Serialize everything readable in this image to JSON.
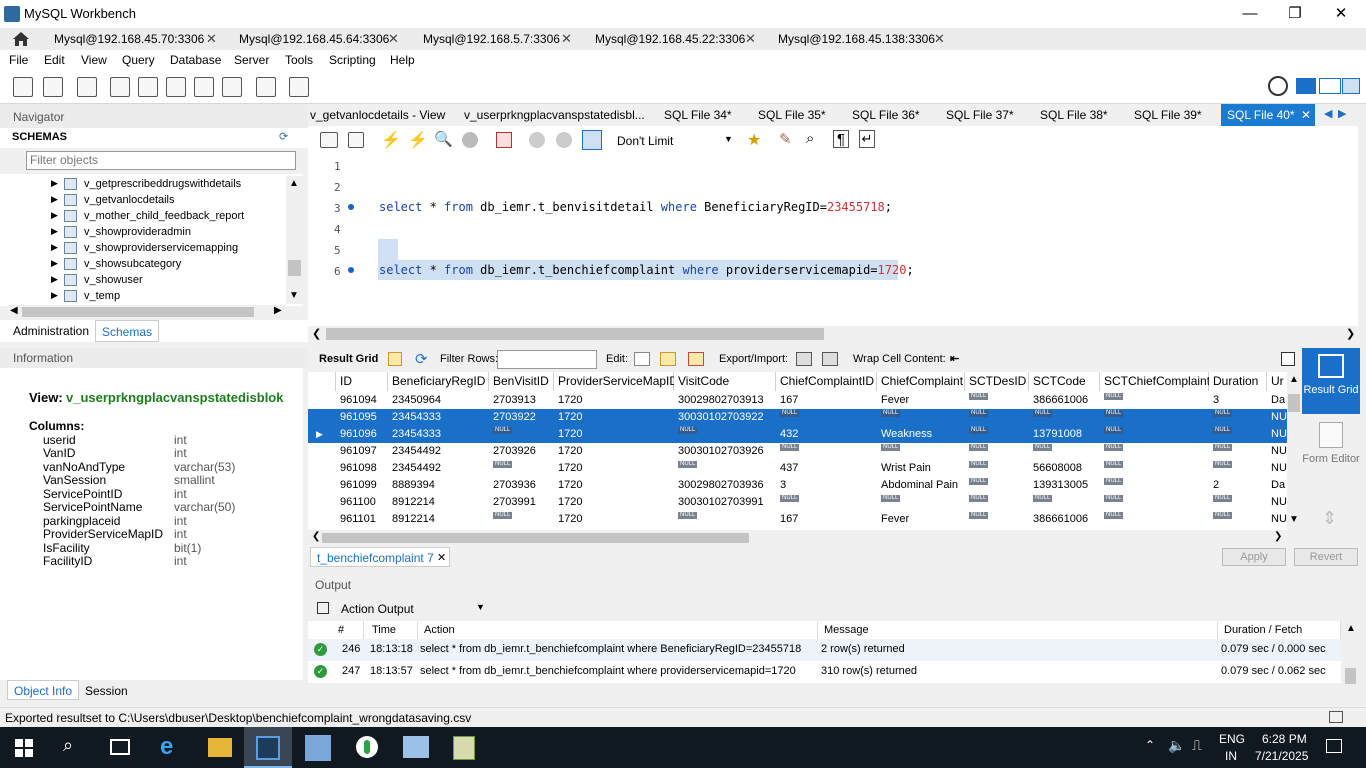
{
  "window": {
    "title": "MySQL Workbench",
    "minimize": "—",
    "maximize": "❐",
    "close": "✕"
  },
  "connection_tabs": [
    {
      "label": "Mysql@192.168.45.70:3306"
    },
    {
      "label": "Mysql@192.168.45.64:3306"
    },
    {
      "label": "Mysql@192.168.5.7:3306"
    },
    {
      "label": "Mysql@192.168.45.22:3306"
    },
    {
      "label": "Mysql@192.168.45.138:3306"
    }
  ],
  "menu": [
    "File",
    "Edit",
    "View",
    "Query",
    "Database",
    "Server",
    "Tools",
    "Scripting",
    "Help"
  ],
  "navigator": {
    "title": "Navigator",
    "schemas_label": "SCHEMAS",
    "filter_placeholder": "Filter objects",
    "tree": [
      "v_getprescribeddrugswithdetails",
      "v_getvanlocdetails",
      "v_mother_child_feedback_report",
      "v_showprovideradmin",
      "v_showproviderservicemapping",
      "v_showsubcategory",
      "v_showuser",
      "v_temp"
    ],
    "tabs": [
      "Administration",
      "Schemas"
    ]
  },
  "information": {
    "title": "Information",
    "view_label": "View:",
    "view_name": "v_userprkngplacvanspstatedisblok",
    "columns_label": "Columns:",
    "columns": [
      {
        "name": "userid",
        "type": "int"
      },
      {
        "name": "VanID",
        "type": "int"
      },
      {
        "name": "vanNoAndType",
        "type": "varchar(53)"
      },
      {
        "name": "VanSession",
        "type": "smallint"
      },
      {
        "name": "ServicePointID",
        "type": "int"
      },
      {
        "name": "ServicePointName",
        "type": "varchar(50)"
      },
      {
        "name": "parkingplaceid",
        "type": "int"
      },
      {
        "name": "ProviderServiceMapID",
        "type": "int"
      },
      {
        "name": "IsFacility",
        "type": "bit(1)"
      },
      {
        "name": "FacilityID",
        "type": "int"
      }
    ],
    "tabs": [
      "Object Info",
      "Session"
    ]
  },
  "sql_tabs": [
    "v_getvanlocdetails - View",
    "v_userprkngplacvanspstatedisbl...",
    "SQL File 34*",
    "SQL File 35*",
    "SQL File 36*",
    "SQL File 37*",
    "SQL File 38*",
    "SQL File 39*"
  ],
  "sql_tab_active": "SQL File 40*",
  "editor_toolbar": {
    "limit": "Don't Limit"
  },
  "editor": {
    "line_numbers": [
      "1",
      "2",
      "3",
      "4",
      "5",
      "6"
    ],
    "line3": {
      "kw1": "select",
      "mid1": " * ",
      "kw2": "from",
      "mid2": " db_iemr.t_benvisitdetail ",
      "kw3": "where",
      "mid3": " BeneficiaryRegID=",
      "num": "23455718",
      "end": ";"
    },
    "line6": {
      "kw1": "select",
      "mid1": " * ",
      "kw2": "from",
      "mid2": " db_iemr.t_benchiefcomplaint ",
      "kw3": "where",
      "mid3": " providerservicemapid=",
      "num": "1720",
      "end": ";"
    }
  },
  "result_toolbar": {
    "result_grid": "Result Grid",
    "filter_rows": "Filter Rows:",
    "edit": "Edit:",
    "export_import": "Export/Import:",
    "wrap": "Wrap Cell Content:"
  },
  "grid": {
    "columns": [
      "ID",
      "BeneficiaryRegID",
      "BenVisitID",
      "ProviderServiceMapID",
      "VisitCode",
      "ChiefComplaintID",
      "ChiefComplaint",
      "SCTDesID",
      "SCTCode",
      "SCTChiefComplaint",
      "Duration",
      "Ur"
    ],
    "null_label": "NULL",
    "rows": [
      [
        "961094",
        "23450964",
        "2703913",
        "1720",
        "30029802703913",
        "167",
        "Fever",
        "NULL",
        "386661006",
        "NULL",
        "3",
        "Da"
      ],
      [
        "961095",
        "23454333",
        "2703922",
        "1720",
        "30030102703922",
        "NULL",
        "NULL",
        "NULL",
        "NULL",
        "NULL",
        "NULL",
        "NUL"
      ],
      [
        "961096",
        "23454333",
        "NULL",
        "1720",
        "NULL",
        "432",
        "Weakness",
        "NULL",
        "13791008",
        "NULL",
        "NULL",
        "NUL"
      ],
      [
        "961097",
        "23454492",
        "2703926",
        "1720",
        "30030102703926",
        "NULL",
        "NULL",
        "NULL",
        "NULL",
        "NULL",
        "NULL",
        "NUL"
      ],
      [
        "961098",
        "23454492",
        "NULL",
        "1720",
        "NULL",
        "437",
        "Wrist Pain",
        "NULL",
        "56608008",
        "NULL",
        "NULL",
        "NUL"
      ],
      [
        "961099",
        "8889394",
        "2703936",
        "1720",
        "30029802703936",
        "3",
        "Abdominal Pain",
        "NULL",
        "139313005",
        "NULL",
        "2",
        "Da"
      ],
      [
        "961100",
        "8912214",
        "2703991",
        "1720",
        "30030102703991",
        "NULL",
        "NULL",
        "NULL",
        "NULL",
        "NULL",
        "NULL",
        "NUL"
      ],
      [
        "961101",
        "8912214",
        "NULL",
        "1720",
        "NULL",
        "167",
        "Fever",
        "NULL",
        "386661006",
        "NULL",
        "NULL",
        "NUL"
      ]
    ]
  },
  "side_panel": {
    "result_grid": "Result Grid",
    "form_editor": "Form Editor"
  },
  "result_tab": "t_benchiefcomplaint 7",
  "result_buttons": {
    "apply": "Apply",
    "revert": "Revert"
  },
  "output": {
    "title": "Output",
    "select": "Action Output",
    "headers": [
      "#",
      "Time",
      "Action",
      "Message",
      "Duration / Fetch"
    ],
    "rows": [
      {
        "num": "246",
        "time": "18:13:18",
        "action": "select * from db_iemr.t_benchiefcomplaint where BeneficiaryRegID=23455718",
        "message": "2 row(s) returned",
        "duration": "0.079 sec / 0.000 sec"
      },
      {
        "num": "247",
        "time": "18:13:57",
        "action": "select * from db_iemr.t_benchiefcomplaint where providerservicemapid=1720",
        "message": "310 row(s) returned",
        "duration": "0.079 sec / 0.062 sec"
      }
    ]
  },
  "status": "Exported resultset to C:\\Users\\dbuser\\Desktop\\benchiefcomplaint_wrongdatasaving.csv",
  "taskbar": {
    "lang1": "ENG",
    "lang2": "IN",
    "time": "6:28 PM",
    "date": "7/21/2025"
  },
  "colors": {
    "accent": "#1a6fc9",
    "taskbar": "#101820",
    "keyword": "#1a44a8"
  }
}
